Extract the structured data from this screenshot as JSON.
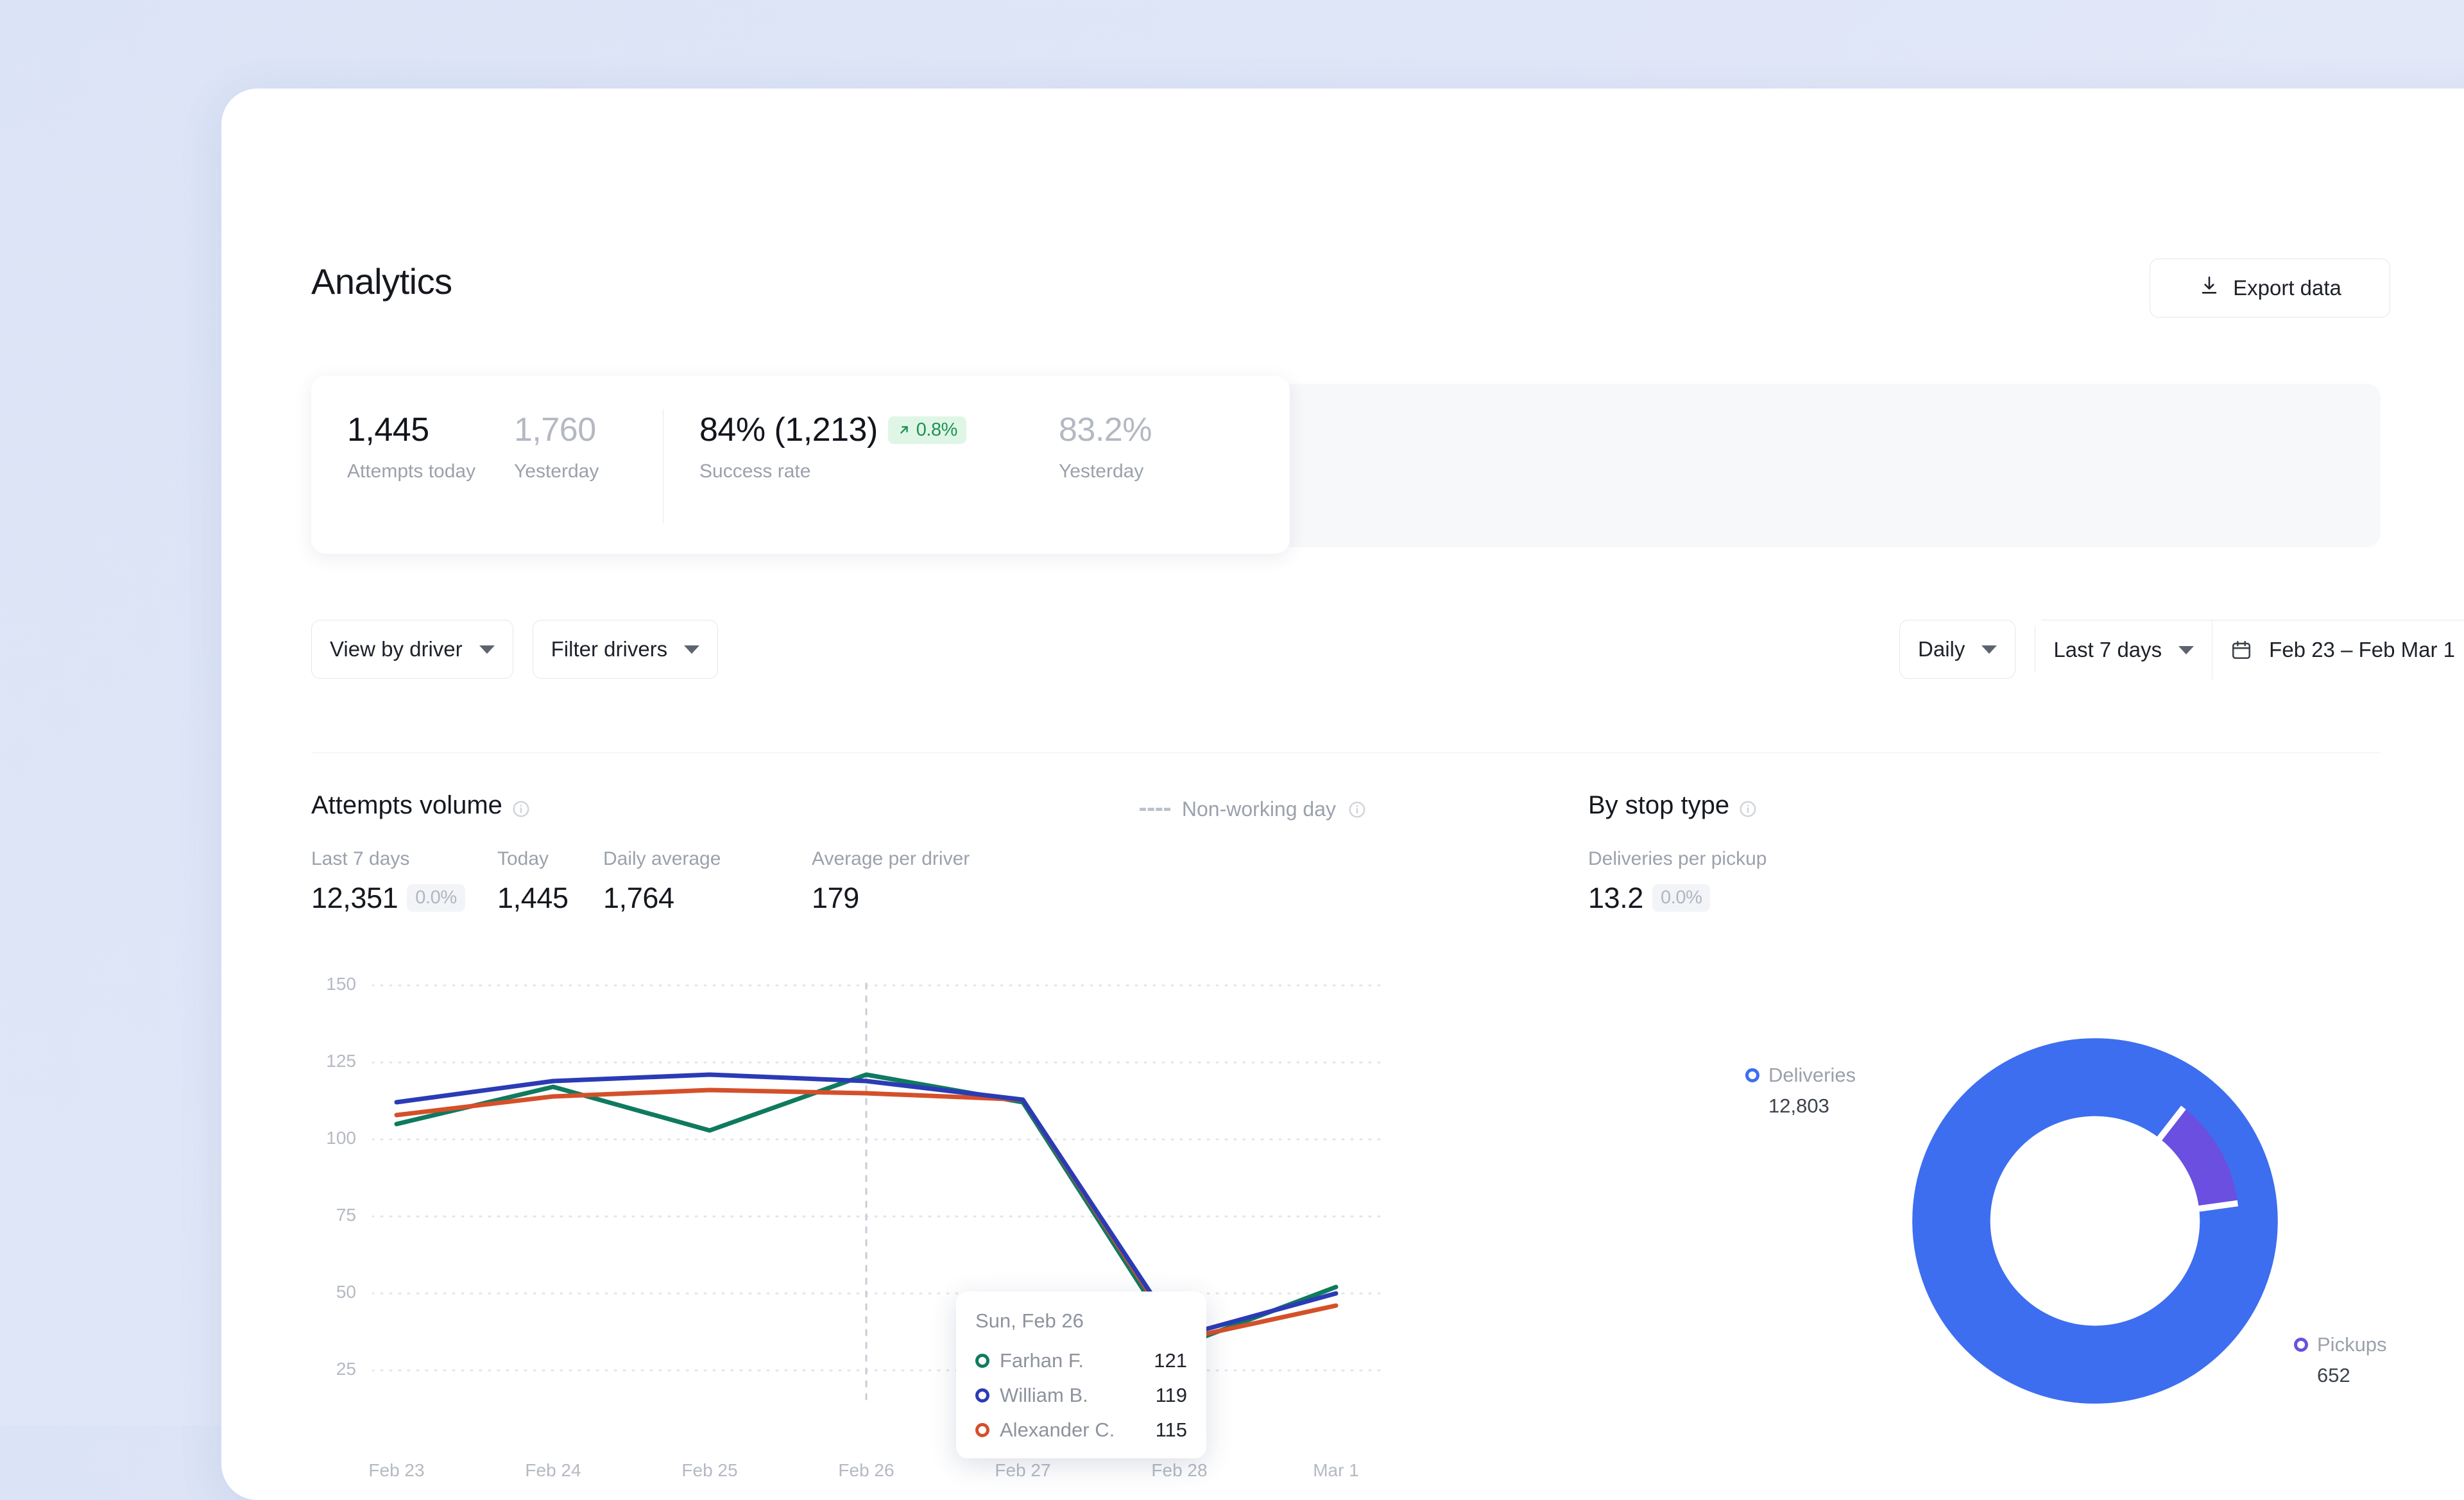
{
  "header": {
    "title": "Analytics",
    "export_label": "Export data",
    "export_icon": "download-icon"
  },
  "kpis": [
    {
      "value": "1,445",
      "label": "Attempts today",
      "tone": "dark"
    },
    {
      "value": "1,760",
      "label": "Yesterday",
      "tone": "muted"
    },
    {
      "value": "84% (1,213)",
      "label": "Success rate",
      "tone": "dark",
      "badge": "0.8%",
      "badge_dir": "up",
      "badge_color": "#1f9254",
      "badge_bg": "#dff6e6"
    },
    {
      "value": "83.2%",
      "label": "Yesterday",
      "tone": "muted"
    }
  ],
  "toolbar": {
    "left": [
      {
        "label": "View by driver",
        "icon": "chevron-down-icon"
      },
      {
        "label": "Filter drivers",
        "icon": "chevron-down-icon"
      }
    ],
    "granularity": {
      "label": "Daily",
      "icon": "chevron-down-icon"
    },
    "range_preset": {
      "label": "Last 7 days",
      "icon": "chevron-down-icon"
    },
    "date_range": {
      "label": "Feb 23 – Feb Mar 1",
      "icon": "calendar-icon",
      "chevron": "chevron-down-icon"
    }
  },
  "attempts_panel": {
    "title": "Attempts volume",
    "info_icon": "info-icon",
    "legend": {
      "label": "Non-working day",
      "icon": "info-icon",
      "swatch": "dashed-line"
    },
    "metrics": [
      {
        "label": "Last 7 days",
        "value": "12,351",
        "chip": "0.0%"
      },
      {
        "label": "Today",
        "value": "1,445"
      },
      {
        "label": "Daily average",
        "value": "1,764"
      },
      {
        "label": "Average per driver",
        "value": "179"
      }
    ],
    "tooltip": {
      "date": "Sun, Feb 26",
      "rows": [
        {
          "name": "Farhan F.",
          "value": "121",
          "color": "#0f7a5f"
        },
        {
          "name": "William B.",
          "value": "119",
          "color": "#2b3bb5"
        },
        {
          "name": "Alexander C.",
          "value": "115",
          "color": "#d4502a"
        }
      ]
    }
  },
  "stop_type_panel": {
    "title": "By stop type",
    "info_icon": "info-icon",
    "metric": {
      "label": "Deliveries per pickup",
      "value": "13.2",
      "chip": "0.0%"
    },
    "legend": [
      {
        "name": "Deliveries",
        "value": "12,803",
        "color": "#3d6ef0"
      },
      {
        "name": "Pickups",
        "value": "652",
        "color": "#6b4fe0"
      }
    ]
  },
  "chart_data": [
    {
      "type": "line",
      "title": "Attempts volume",
      "xlabel": "",
      "ylabel": "",
      "x": [
        "Feb 23",
        "Feb 24",
        "Feb 25",
        "Feb 26",
        "Feb 27",
        "Feb 28",
        "Mar 1"
      ],
      "ylim": [
        0,
        150
      ],
      "yticks": [
        25,
        50,
        75,
        100,
        125,
        150
      ],
      "grid": "horizontal-dotted",
      "legend": "hidden",
      "annotations": [
        "Non-working day marker at Feb 26 (vertical dotted line)"
      ],
      "series": [
        {
          "name": "Farhan F.",
          "color": "#0f7a5f",
          "values": [
            105,
            117,
            103,
            121,
            112,
            33,
            52
          ]
        },
        {
          "name": "William B.",
          "color": "#2b3bb5",
          "values": [
            112,
            119,
            121,
            119,
            113,
            36,
            50
          ]
        },
        {
          "name": "Alexander C.",
          "color": "#d4502a",
          "values": [
            108,
            114,
            116,
            115,
            113,
            35,
            46
          ]
        }
      ]
    },
    {
      "type": "pie",
      "title": "By stop type",
      "subtitle": "Deliveries per pickup",
      "donut": true,
      "legend": "outside",
      "labels": [
        "Deliveries",
        "Pickups"
      ],
      "values": [
        12803,
        652
      ],
      "colors": [
        "#3d6ef0",
        "#6b4fe0"
      ]
    }
  ]
}
